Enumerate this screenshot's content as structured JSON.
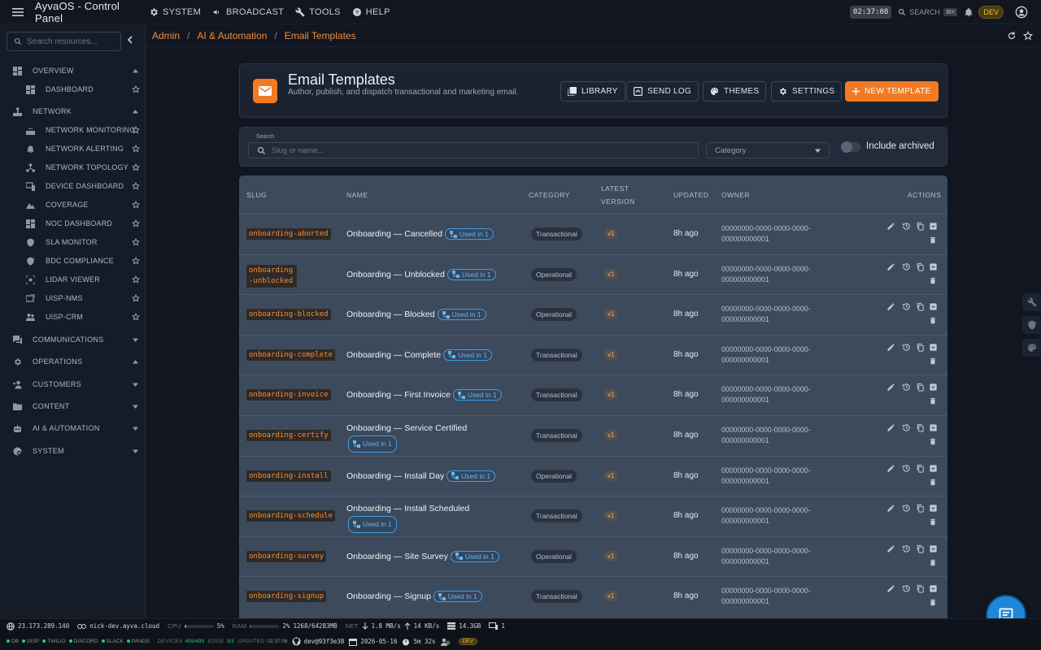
{
  "app": {
    "title": "AyvaOS - Control Panel"
  },
  "topnav": [
    {
      "label": "SYSTEM",
      "icon": "gear-icon"
    },
    {
      "label": "BROADCAST",
      "icon": "megaphone-icon"
    },
    {
      "label": "TOOLS",
      "icon": "wrench-icon"
    },
    {
      "label": "HELP",
      "icon": "help-icon"
    }
  ],
  "topright": {
    "clock": "02:37:08",
    "search_label": "SEARCH",
    "search_shortcut": "⌘K",
    "env": "DEV"
  },
  "sidebar": {
    "search_placeholder": "Search resources...",
    "overview": {
      "label": "OVERVIEW",
      "items": [
        {
          "label": "DASHBOARD"
        }
      ]
    },
    "network": {
      "label": "NETWORK",
      "items": [
        {
          "label": "NETWORK MONITORING"
        },
        {
          "label": "NETWORK ALERTING"
        },
        {
          "label": "NETWORK TOPOLOGY"
        },
        {
          "label": "DEVICE DASHBOARD"
        },
        {
          "label": "COVERAGE"
        },
        {
          "label": "NOC DASHBOARD"
        },
        {
          "label": "SLA MONITOR"
        },
        {
          "label": "BDC COMPLIANCE"
        },
        {
          "label": "LIDAR VIEWER"
        },
        {
          "label": "UISP-NMS"
        },
        {
          "label": "UISP-CRM"
        }
      ]
    },
    "sections": [
      {
        "label": "COMMUNICATIONS"
      },
      {
        "label": "OPERATIONS"
      },
      {
        "label": "CUSTOMERS"
      },
      {
        "label": "CONTENT"
      },
      {
        "label": "AI & AUTOMATION"
      },
      {
        "label": "SYSTEM"
      }
    ]
  },
  "breadcrumb": [
    "Admin",
    "AI & Automation",
    "Email Templates"
  ],
  "page": {
    "title": "Email Templates",
    "subtitle": "Author, publish, and dispatch transactional and marketing email.",
    "buttons": {
      "library": "LIBRARY",
      "send_log": "SEND LOG",
      "themes": "THEMES",
      "settings": "SETTINGS",
      "new_template": "NEW TEMPLATE"
    }
  },
  "filters": {
    "search_label": "Search",
    "search_placeholder": "Slug or name...",
    "category_placeholder": "Category",
    "include_archived": "Include archived"
  },
  "table": {
    "headers": {
      "slug": "SLUG",
      "name": "NAME",
      "category": "CATEGORY",
      "latest_version_1": "LATEST",
      "latest_version_2": "VERSION",
      "updated": "UPDATED",
      "owner": "OWNER",
      "actions": "ACTIONS"
    },
    "rows": [
      {
        "slug": "onboarding-aborted",
        "name": "Onboarding — Cancelled",
        "used": "Used in 1",
        "category": "Transactional",
        "version": "v1",
        "updated": "8h ago",
        "owner": "00000000-0000-0000-0000-000000000001"
      },
      {
        "slug": "onboarding-unblocked",
        "name": "Onboarding — Unblocked",
        "used": "Used in 1",
        "category": "Operational",
        "version": "v1",
        "updated": "8h ago",
        "owner": "00000000-0000-0000-0000-000000000001"
      },
      {
        "slug": "onboarding-blocked",
        "name": "Onboarding — Blocked",
        "used": "Used in 1",
        "category": "Operational",
        "version": "v1",
        "updated": "8h ago",
        "owner": "00000000-0000-0000-0000-000000000001"
      },
      {
        "slug": "onboarding-complete",
        "name": "Onboarding — Complete",
        "used": "Used in 1",
        "category": "Transactional",
        "version": "v1",
        "updated": "8h ago",
        "owner": "00000000-0000-0000-0000-000000000001"
      },
      {
        "slug": "onboarding-invoice",
        "name": "Onboarding — First Invoice",
        "used": "Used in 1",
        "category": "Transactional",
        "version": "v1",
        "updated": "8h ago",
        "owner": "00000000-0000-0000-0000-000000000001"
      },
      {
        "slug": "onboarding-certify",
        "name": "Onboarding — Service Certified",
        "used": "Used in 1",
        "category": "Transactional",
        "version": "v1",
        "updated": "8h ago",
        "owner": "00000000-0000-0000-0000-000000000001"
      },
      {
        "slug": "onboarding-install",
        "name": "Onboarding — Install Day",
        "used": "Used in 1",
        "category": "Operational",
        "version": "v1",
        "updated": "8h ago",
        "owner": "00000000-0000-0000-0000-000000000001"
      },
      {
        "slug": "onboarding-schedule",
        "name": "Onboarding — Install Scheduled",
        "used": "Used in 1",
        "category": "Transactional",
        "version": "v1",
        "updated": "8h ago",
        "owner": "00000000-0000-0000-0000-000000000001"
      },
      {
        "slug": "onboarding-survey",
        "name": "Onboarding — Site Survey",
        "used": "Used in 1",
        "category": "Operational",
        "version": "v1",
        "updated": "8h ago",
        "owner": "00000000-0000-0000-0000-000000000001"
      },
      {
        "slug": "onboarding-signup",
        "name": "Onboarding — Signup",
        "used": "Used in 1",
        "category": "Transactional",
        "version": "v1",
        "updated": "8h ago",
        "owner": "00000000-0000-0000-0000-000000000001"
      }
    ]
  },
  "status": {
    "ip": "23.173.289.140",
    "host": "nick-dev.ayva.cloud",
    "cpu_label": "CPU",
    "cpu_value": "5%",
    "cpu_fraction": 0.05,
    "ram_label": "RAM",
    "ram_value": "2%",
    "ram_fraction": 0.02,
    "ram_detail": "1268/64283MB",
    "net_label": "NET",
    "net_down": "1.8 MB/s",
    "net_up": "14 KB/s",
    "disk": "14.3GB",
    "screens": "1",
    "services": [
      "DB",
      "UISP",
      "TWILIO",
      "DISCORD",
      "SLACK",
      "PANDS"
    ],
    "devices_label": "DEVICES",
    "devices_value": "455/499",
    "edge_label": "EDGE",
    "edge_value": "3/3",
    "updated_label": "UPDATED",
    "updated_value": "02:37:08",
    "commit": "dev@93f3e38",
    "date": "2026-05-16",
    "uptime": "5m 32s",
    "env": "DEV"
  },
  "colors": {
    "accent": "#f27a22",
    "link": "#3aa0e8",
    "status_ok": "#3ac46b"
  }
}
